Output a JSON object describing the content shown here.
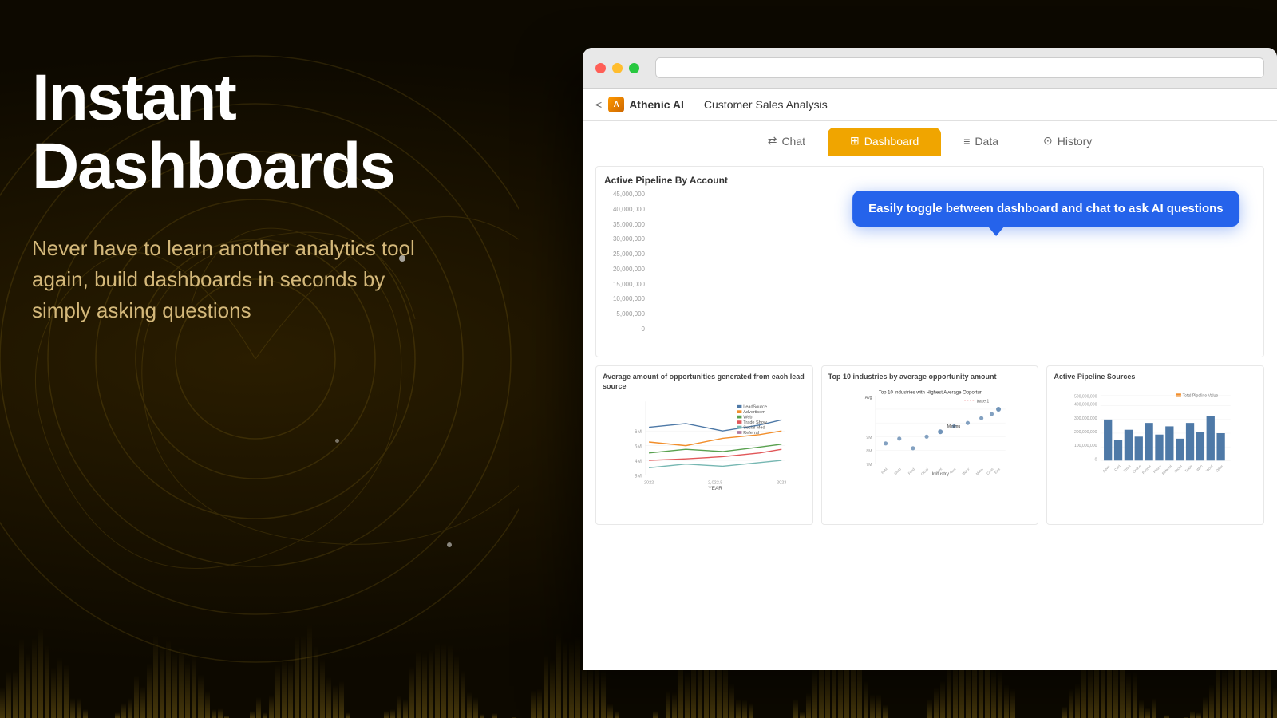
{
  "background": {
    "color1": "#1a1200",
    "color2": "#2a1d00"
  },
  "left": {
    "headline_line1": "Instant",
    "headline_line2": "Dashboards",
    "subtext": "Never have to learn another analytics tool again, build dashboards in seconds by simply asking questions"
  },
  "browser": {
    "back_label": "<",
    "logo_text": "Athenic AI",
    "breadcrumb": "Customer Sales Analysis",
    "tabs": [
      {
        "id": "chat",
        "label": "Chat",
        "icon": "⇄",
        "active": false
      },
      {
        "id": "dashboard",
        "label": "Dashboard",
        "icon": "⊞",
        "active": true
      },
      {
        "id": "data",
        "label": "Data",
        "icon": "≡",
        "active": false
      },
      {
        "id": "history",
        "label": "History",
        "icon": "⊙",
        "active": false
      }
    ],
    "tooltip": "Easily toggle between dashboard and chat to ask AI questions",
    "main_chart": {
      "title": "Active Pipeline By Account",
      "y_labels": [
        "45,000,000",
        "40,000,000",
        "35,000,000",
        "30,000,000",
        "25,000,000",
        "20,000,000",
        "15,000,000",
        "10,000,000",
        "5,000,000",
        "0"
      ]
    },
    "bottom_charts": [
      {
        "title": "Average amount of opportunities generated from each lead source",
        "subtitle": "LeadSource",
        "legend": [
          "Advertisem",
          "Web",
          "Trade Show",
          "Social Med",
          "Referral"
        ]
      },
      {
        "title": "Top 10 industries by average opportunity amount",
        "subtitle": "Top 10 Industries with Highest Average Opportur"
      },
      {
        "title": "Active Pipeline Sources",
        "subtitle": "Total Pipeline Value"
      }
    ]
  }
}
